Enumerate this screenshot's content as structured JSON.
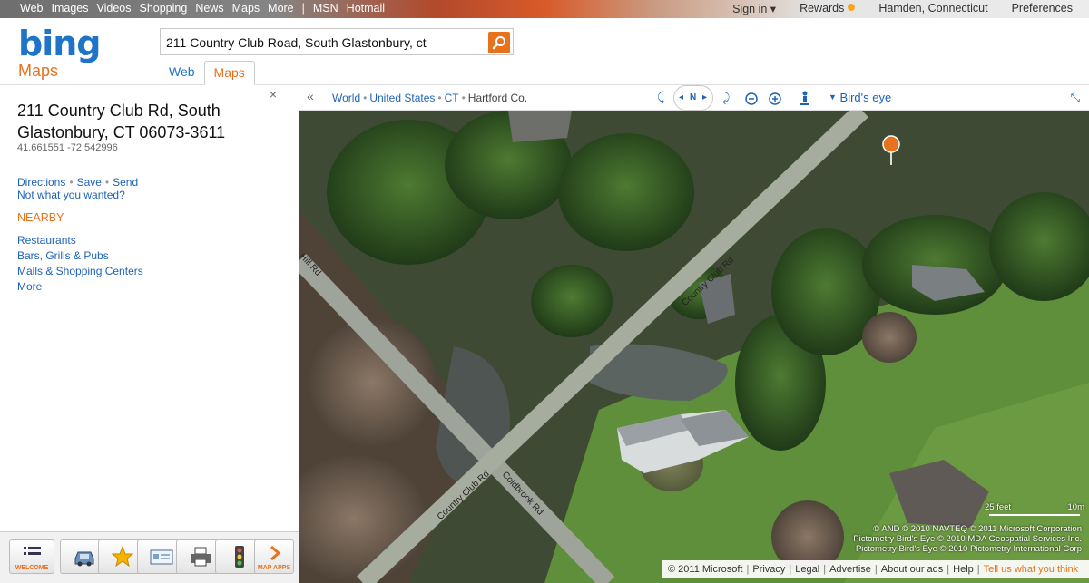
{
  "topnav": {
    "links": [
      "Web",
      "Images",
      "Videos",
      "Shopping",
      "News",
      "Maps",
      "More",
      "|",
      "MSN",
      "Hotmail"
    ],
    "sign_in": "Sign in ▾",
    "rewards": "Rewards",
    "location": "Hamden, Connecticut",
    "preferences": "Preferences"
  },
  "header": {
    "logo": "bing",
    "logo_sub": "Maps",
    "search_value": "211 Country Club Road, South Glastonbury, ct",
    "tabs": [
      "Web",
      "Maps"
    ],
    "active_tab": "Maps"
  },
  "panel": {
    "close": "×",
    "address_line1": "211 Country Club Rd, South",
    "address_line2": "Glastonbury, CT 06073-3611",
    "coords": "41.661551 -72.542996",
    "actions": [
      "Directions",
      "Save",
      "Send"
    ],
    "not_wanted": "Not what you wanted?",
    "nearby_heading": "NEARBY",
    "nearby": [
      "Restaurants",
      "Bars, Grills & Pubs",
      "Malls & Shopping Centers",
      "More"
    ],
    "toolbar": [
      {
        "icon": "list-icon",
        "caption": "WELCOME"
      },
      {
        "icon": "car-icon",
        "caption": ""
      },
      {
        "icon": "star-icon",
        "caption": ""
      },
      {
        "icon": "card-icon",
        "caption": ""
      },
      {
        "icon": "printer-icon",
        "caption": ""
      },
      {
        "icon": "traffic-light-icon",
        "caption": ""
      },
      {
        "icon": "chevron-right-icon",
        "caption": "MAP APPS"
      }
    ]
  },
  "mapbar": {
    "collapse": "«",
    "breadcrumb": [
      "World",
      "United States",
      "CT",
      "Hartford Co."
    ],
    "compass_n": "N",
    "view_mode": "Bird's eye"
  },
  "map": {
    "roads": [
      "Country Club Rd",
      "Country Club Rd",
      "Coldbrook Rd",
      "Hill Rd"
    ],
    "scale_feet": "25 feet",
    "scale_m": "10m",
    "attribution": [
      "© AND  © 2010 NAVTEQ  © 2011 Microsoft Corporation",
      "Pictometry Bird's Eye © 2010 MDA Geospatial Services Inc.",
      "Pictometry Bird's Eye © 2010 Pictometry International Corp"
    ],
    "pin_color": "#e8721c"
  },
  "footer": {
    "copyright": "© 2011 Microsoft",
    "links": [
      "Privacy",
      "Legal",
      "Advertise",
      "About our ads",
      "Help"
    ],
    "tell": "Tell us what you think"
  }
}
